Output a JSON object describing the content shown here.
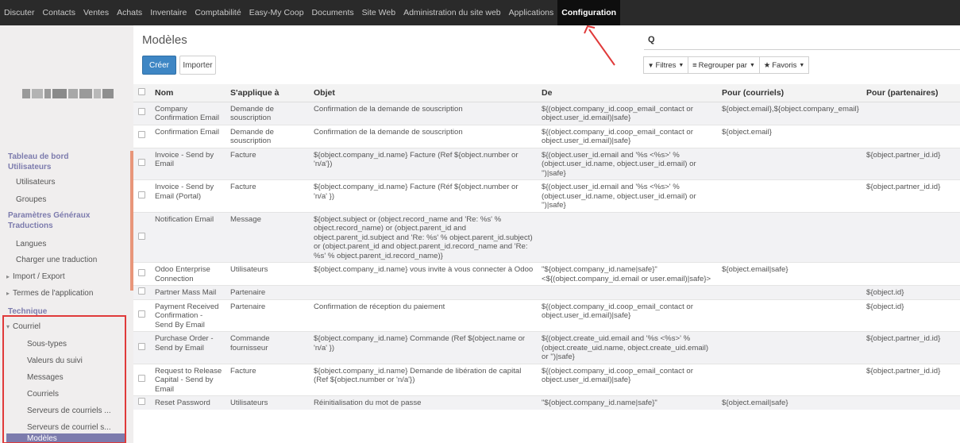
{
  "topbar": {
    "menus": [
      "Discuter",
      "Contacts",
      "Ventes",
      "Achats",
      "Inventaire",
      "Comptabilité",
      "Easy-My Coop",
      "Documents",
      "Site Web",
      "Administration du site web",
      "Applications",
      "Configuration"
    ],
    "active": "Configuration"
  },
  "sidebar": {
    "headings": {
      "dashboard": "Tableau de bord",
      "users": "Utilisateurs",
      "general": "Paramètres Généraux",
      "translations": "Traductions",
      "technical": "Technique"
    },
    "items": {
      "users": "Utilisateurs",
      "groups": "Groupes",
      "languages": "Langues",
      "load_translation": "Charger une traduction",
      "import_export": "Import / Export",
      "app_terms": "Termes de l'application",
      "email": "Courriel"
    },
    "email_sub": [
      "Sous-types",
      "Valeurs du suivi",
      "Messages",
      "Courriels",
      "Serveurs de courriels ...",
      "Serveurs de courriel s..."
    ],
    "active": "Modèles"
  },
  "page": {
    "title": "Modèles",
    "create": "Créer",
    "import": "Importer",
    "search_icon": "Q",
    "filters": "Filtres",
    "group_by": "Regrouper par",
    "favorites": "Favoris"
  },
  "table": {
    "columns": [
      "Nom",
      "S'applique à",
      "Objet",
      "De",
      "Pour (courriels)",
      "Pour (partenaires)"
    ],
    "rows": [
      {
        "name": "Company Confirmation Email",
        "model": "Demande de souscription",
        "subject": "Confirmation de la demande de souscription",
        "from": "${(object.company_id.coop_email_contact or object.user_id.email)|safe}",
        "email_to": "${object.email},${object.company_email}",
        "partner_to": ""
      },
      {
        "name": "Confirmation Email",
        "model": "Demande de souscription",
        "subject": "Confirmation de la demande de souscription",
        "from": "${(object.company_id.coop_email_contact or object.user_id.email)|safe}",
        "email_to": "${object.email}",
        "partner_to": ""
      },
      {
        "name": "Invoice - Send by Email",
        "model": "Facture",
        "subject": "${object.company_id.name} Facture (Ref ${object.number or 'n/a'})",
        "from": "${(object.user_id.email and '%s <%s>' % (object.user_id.name, object.user_id.email) or '')|safe}",
        "email_to": "",
        "partner_to": "${object.partner_id.id}"
      },
      {
        "name": "Invoice - Send by Email (Portal)",
        "model": "Facture",
        "subject": "${object.company_id.name} Facture (Réf ${object.number or 'n/a' })",
        "from": "${(object.user_id.email and '%s <%s>' % (object.user_id.name, object.user_id.email) or '')|safe}",
        "email_to": "",
        "partner_to": "${object.partner_id.id}"
      },
      {
        "name": "Notification Email",
        "model": "Message",
        "subject": "${object.subject or (object.record_name and 'Re: %s' % object.record_name) or (object.parent_id and object.parent_id.subject and 'Re: %s' % object.parent_id.subject) or (object.parent_id and object.parent_id.record_name and 'Re: %s' % object.parent_id.record_name)}",
        "from": "",
        "email_to": "",
        "partner_to": ""
      },
      {
        "name": "Odoo Enterprise Connection",
        "model": "Utilisateurs",
        "subject": "${object.company_id.name} vous invite à vous connecter à Odoo",
        "from": "\"${object.company_id.name|safe}\" <${(object.company_id.email or user.email)|safe}>",
        "email_to": "${object.email|safe}",
        "partner_to": ""
      },
      {
        "name": "Partner Mass Mail",
        "model": "Partenaire",
        "subject": "",
        "from": "",
        "email_to": "",
        "partner_to": "${object.id}"
      },
      {
        "name": "Payment Received Confirmation - Send By Email",
        "model": "Partenaire",
        "subject": "Confirmation de réception du paiement",
        "from": "${(object.company_id.coop_email_contact or object.user_id.email)|safe}",
        "email_to": "",
        "partner_to": "${object.id}"
      },
      {
        "name": "Purchase Order - Send by Email",
        "model": "Commande fournisseur",
        "subject": "${object.company_id.name} Commande (Ref ${object.name or 'n/a' })",
        "from": "${(object.create_uid.email and '%s <%s>' % (object.create_uid.name, object.create_uid.email) or '')|safe}",
        "email_to": "",
        "partner_to": "${object.partner_id.id}"
      },
      {
        "name": "Request to Release Capital - Send by Email",
        "model": "Facture",
        "subject": "${object.company_id.name} Demande de libération de capital (Ref ${object.number or 'n/a'})",
        "from": "${(object.company_id.coop_email_contact or object.user_id.email)|safe}",
        "email_to": "",
        "partner_to": "${object.partner_id.id}"
      },
      {
        "name": "Reset Password",
        "model": "Utilisateurs",
        "subject": "Réinitialisation du mot de passe",
        "from": "\"${object.company_id.name|safe}\"",
        "email_to": "${object.email|safe}",
        "partner_to": ""
      }
    ]
  },
  "colors": {
    "topbar": "#2a2a2a",
    "accent": "#7c7bad",
    "primary_button": "#3e86c4",
    "annotation": "#e03a3a"
  }
}
